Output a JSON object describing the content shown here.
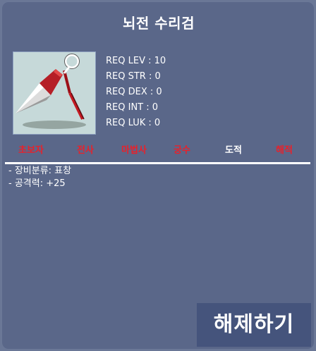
{
  "item": {
    "name": "뇌전 수리검",
    "image_icon": "throwing-star-icon"
  },
  "requirements": [
    {
      "label": "REQ LEV",
      "value": "10",
      "text": "REQ LEV : 10"
    },
    {
      "label": "REQ STR",
      "value": "0",
      "text": "REQ STR : 0"
    },
    {
      "label": "REQ DEX",
      "value": "0",
      "text": "REQ DEX : 0"
    },
    {
      "label": "REQ INT",
      "value": "0",
      "text": "REQ INT : 0"
    },
    {
      "label": "REQ LUK",
      "value": "0",
      "text": "REQ LUK : 0"
    }
  ],
  "jobs": [
    {
      "name": "초보자",
      "available": false,
      "color": "#e8212b"
    },
    {
      "name": "전사",
      "available": false,
      "color": "#e8212b"
    },
    {
      "name": "마법사",
      "available": false,
      "color": "#e8212b"
    },
    {
      "name": "궁수",
      "available": false,
      "color": "#e8212b"
    },
    {
      "name": "도적",
      "available": true,
      "color": "#ffffff"
    },
    {
      "name": "해적",
      "available": false,
      "color": "#e8212b"
    }
  ],
  "stats": [
    "- 장비분류: 표창",
    "- 공격력: +25"
  ],
  "unequip_button": {
    "label": "해제하기"
  },
  "colors": {
    "panel": "#5a6789",
    "button": "#45547c",
    "unavailable_job": "#e8212b",
    "available_job": "#ffffff"
  }
}
